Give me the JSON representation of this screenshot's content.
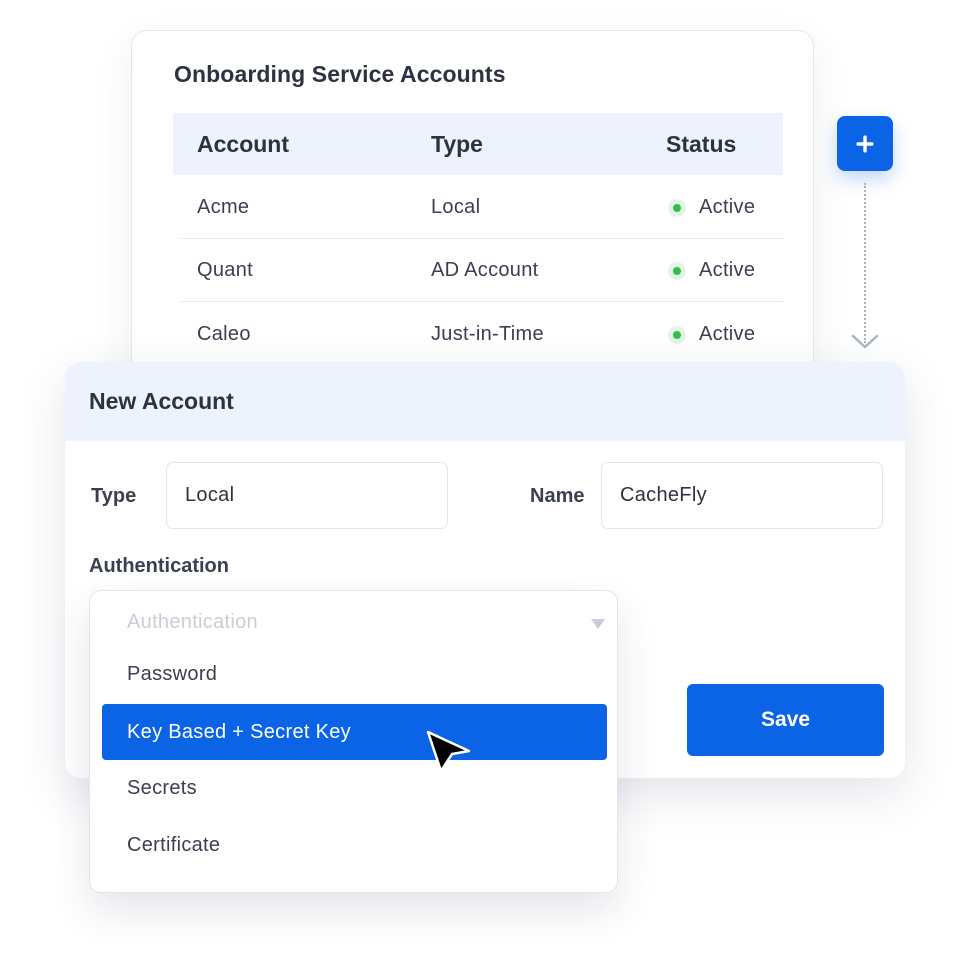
{
  "accounts_card": {
    "title": "Onboarding Service Accounts",
    "columns": [
      "Account",
      "Type",
      "Status"
    ],
    "rows": [
      {
        "account": "Acme",
        "type": "Local",
        "status": "Active"
      },
      {
        "account": "Quant",
        "type": "AD Account",
        "status": "Active"
      },
      {
        "account": "Caleo",
        "type": "Just-in-Time",
        "status": "Active"
      }
    ],
    "add_icon": "plus-icon"
  },
  "new_account": {
    "title": "New Account",
    "type_label": "Type",
    "type_value": "Local",
    "name_label": "Name",
    "name_value": "CacheFly",
    "auth_label": "Authentication",
    "save_label": "Save"
  },
  "auth_dropdown": {
    "placeholder": "Authentication",
    "options": [
      "Password",
      "Key Based + Secret Key",
      "Secrets",
      "Certificate"
    ],
    "selected": "Key Based + Secret Key",
    "caret_icon": "caret-down-icon"
  },
  "colors": {
    "accent": "#0b63e5",
    "header_bg": "#eef2fd",
    "status_active": "#2fbf4a"
  }
}
